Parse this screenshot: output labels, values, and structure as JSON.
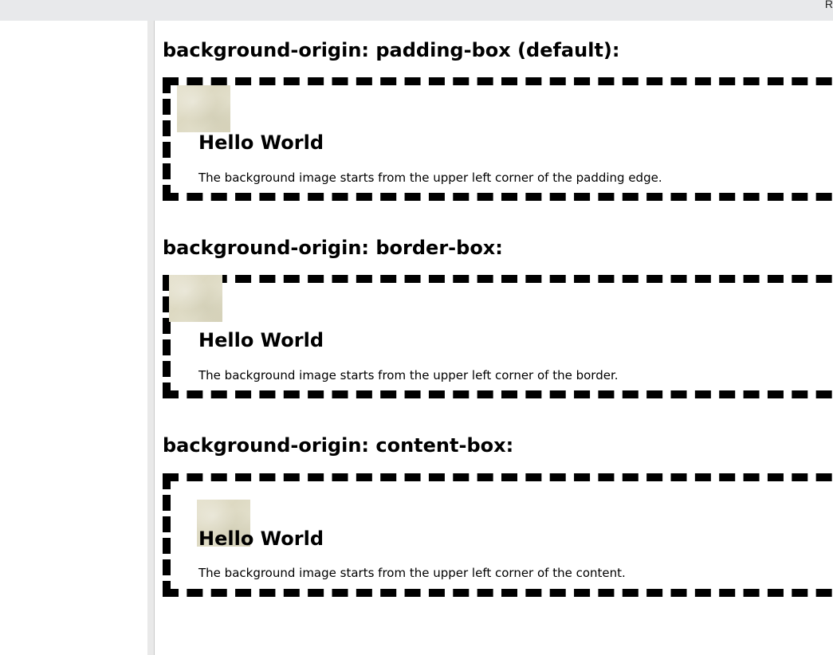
{
  "window": {
    "corner_text": "R"
  },
  "sections": [
    {
      "title": "background-origin: padding-box (default):",
      "heading": "Hello World",
      "text": "The background image starts from the upper left corner of the padding edge."
    },
    {
      "title": "background-origin: border-box:",
      "heading": "Hello World",
      "text": "The background image starts from the upper left corner of the border."
    },
    {
      "title": "background-origin: content-box:",
      "heading": "Hello World",
      "text": "The background image starts from the upper left corner of the content."
    }
  ],
  "colors": {
    "border": "#000000",
    "background_image_tint": "#e2decb",
    "toolbar": "#e8e9eb"
  }
}
